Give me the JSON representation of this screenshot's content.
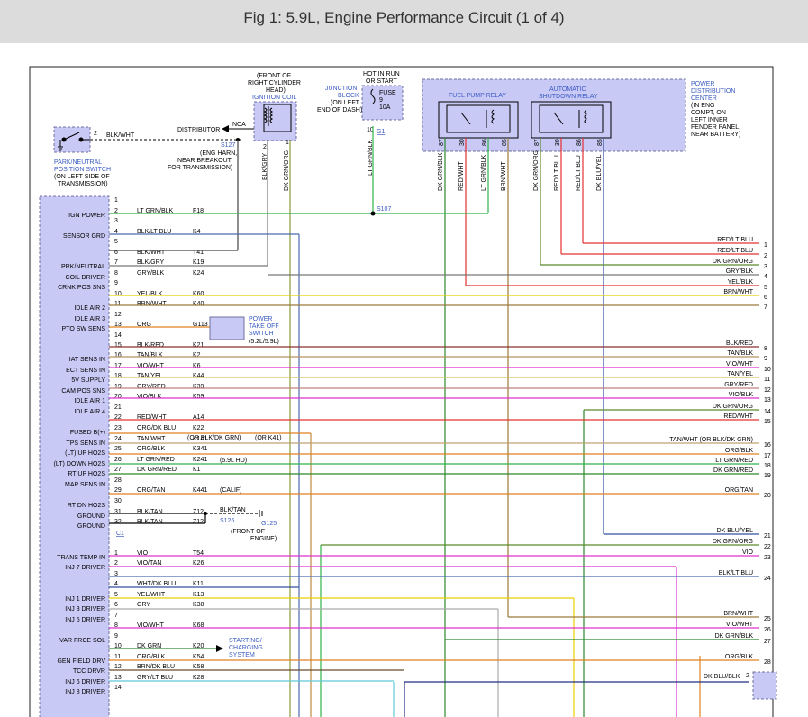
{
  "title": "Fig 1: 5.9L, Engine Performance Circuit (1 of 4)",
  "colors": {
    "box_fill": "#c9c9f5",
    "box_stroke": "#7070a0",
    "label_blue": "#3b5bc2",
    "frame": "#222222"
  },
  "pcm": {
    "c1": "C1",
    "rows": [
      {
        "pin": "1",
        "label": "",
        "wire": "",
        "code": ""
      },
      {
        "pin": "2",
        "label": "IGN POWER",
        "wire": "LT GRN/BLK",
        "code": "F18"
      },
      {
        "pin": "3",
        "label": "",
        "wire": "",
        "code": ""
      },
      {
        "pin": "4",
        "label": "SENSOR GRD",
        "wire": "BLK/LT BLU",
        "code": "K4"
      },
      {
        "pin": "5",
        "label": "",
        "wire": "",
        "code": ""
      },
      {
        "pin": "6",
        "label": "",
        "wire": "BLK/WHT",
        "code": "T41"
      },
      {
        "pin": "7",
        "label": "PRK/NEUTRAL",
        "wire": "BLK/GRY",
        "code": "K19"
      },
      {
        "pin": "8",
        "label": "COIL DRIVER",
        "wire": "GRY/BLK",
        "code": "K24"
      },
      {
        "pin": "9",
        "label": "CRNK POS SNS",
        "wire": "",
        "code": ""
      },
      {
        "pin": "10",
        "label": "",
        "wire": "YEL/BLK",
        "code": "K60"
      },
      {
        "pin": "11",
        "label": "IDLE AIR 2",
        "wire": "BRN/WHT",
        "code": "K40"
      },
      {
        "pin": "12",
        "label": "IDLE AIR 3",
        "wire": "",
        "code": ""
      },
      {
        "pin": "13",
        "label": "PTO SW SENS",
        "wire": "ORG",
        "code": "G113"
      },
      {
        "pin": "14",
        "label": "",
        "wire": "",
        "code": ""
      },
      {
        "pin": "15",
        "label": "",
        "wire": "BLK/RED",
        "code": "K21"
      },
      {
        "pin": "16",
        "label": "IAT SENS IN",
        "wire": "TAN/BLK",
        "code": "K2"
      },
      {
        "pin": "17",
        "label": "ECT SENS IN",
        "wire": "VIO/WHT",
        "code": "K6"
      },
      {
        "pin": "18",
        "label": "5V SUPPLY",
        "wire": "TAN/YEL",
        "code": "K44"
      },
      {
        "pin": "19",
        "label": "CAM POS SNS",
        "wire": "GRY/RED",
        "code": "K39"
      },
      {
        "pin": "20",
        "label": "IDLE AIR 1",
        "wire": "VIO/BLK",
        "code": "K59"
      },
      {
        "pin": "21",
        "label": "IDLE AIR 4",
        "wire": "",
        "code": ""
      },
      {
        "pin": "22",
        "label": "",
        "wire": "RED/WHT",
        "code": "A14"
      },
      {
        "pin": "23",
        "label": "FUSED B(+)",
        "wire": "ORG/DK BLU",
        "code": "K22"
      },
      {
        "pin": "24",
        "label": "TPS SENS IN",
        "wire": "TAN/WHT",
        "code": "K141"
      },
      {
        "pin": "25",
        "label": "(LT) UP HO2S",
        "wire": "ORG/BLK",
        "code": "K341"
      },
      {
        "pin": "26",
        "label": "(LT) DOWN HO2S",
        "wire": "LT GRN/RED",
        "code": "K241"
      },
      {
        "pin": "27",
        "label": "RT UP HO2S",
        "wire": "DK GRN/RED",
        "code": "K1"
      },
      {
        "pin": "28",
        "label": "MAP SENS IN",
        "wire": "",
        "code": ""
      },
      {
        "pin": "29",
        "label": "",
        "wire": "ORG/TAN",
        "code": "K441"
      },
      {
        "pin": "30",
        "label": "RT DN HO2S",
        "wire": "",
        "code": ""
      },
      {
        "pin": "31",
        "label": "GROUND",
        "wire": "BLK/TAN",
        "code": "Z12"
      },
      {
        "pin": "32",
        "label": "GROUND",
        "wire": "BLK/TAN",
        "code": "Z12"
      }
    ],
    "rows2": [
      {
        "pin": "1",
        "label": "TRANS TEMP IN",
        "wire": "VIO",
        "code": "T54"
      },
      {
        "pin": "2",
        "label": "INJ 7 DRIVER",
        "wire": "VIO/TAN",
        "code": "K26"
      },
      {
        "pin": "3",
        "label": "",
        "wire": "",
        "code": ""
      },
      {
        "pin": "4",
        "label": "",
        "wire": "WHT/DK BLU",
        "code": "K11"
      },
      {
        "pin": "5",
        "label": "INJ 1 DRIVER",
        "wire": "YEL/WHT",
        "code": "K13"
      },
      {
        "pin": "6",
        "label": "INJ 3 DRIVER",
        "wire": "GRY",
        "code": "K38"
      },
      {
        "pin": "7",
        "label": "INJ 5 DRIVER",
        "wire": "",
        "code": ""
      },
      {
        "pin": "8",
        "label": "",
        "wire": "VIO/WHT",
        "code": "K68"
      },
      {
        "pin": "9",
        "label": "VAR FRCE SOL",
        "wire": "",
        "code": ""
      },
      {
        "pin": "10",
        "label": "",
        "wire": "DK GRN",
        "code": "K20"
      },
      {
        "pin": "11",
        "label": "GEN FIELD DRV",
        "wire": "ORG/BLK",
        "code": "K54"
      },
      {
        "pin": "12",
        "label": "TCC DRVR",
        "wire": "BRN/DK BLU",
        "code": "K58"
      },
      {
        "pin": "13",
        "label": "INJ 6 DRIVER",
        "wire": "GRY/LT BLU",
        "code": "K28"
      },
      {
        "pin": "14",
        "label": "INJ 8 DRIVER",
        "wire": "",
        "code": ""
      }
    ]
  },
  "right_wires": [
    {
      "num": "1",
      "label": "RED/LT BLU"
    },
    {
      "num": "2",
      "label": "RED/LT BLU"
    },
    {
      "num": "3",
      "label": "DK GRN/ORG"
    },
    {
      "num": "4",
      "label": "GRY/BLK"
    },
    {
      "num": "5",
      "label": "YEL/BLK"
    },
    {
      "num": "6",
      "label": "BRN/WHT"
    },
    {
      "num": "7",
      "label": ""
    },
    {
      "num": "8",
      "label": "BLK/RED"
    },
    {
      "num": "9",
      "label": "TAN/BLK"
    },
    {
      "num": "10",
      "label": "VIO/WHT"
    },
    {
      "num": "11",
      "label": "TAN/YEL"
    },
    {
      "num": "12",
      "label": "GRY/RED"
    },
    {
      "num": "13",
      "label": "VIO/BLK"
    },
    {
      "num": "14",
      "label": "DK GRN/ORG"
    },
    {
      "num": "15",
      "label": "RED/WHT"
    },
    {
      "num": "16",
      "label": "TAN/WHT (OR BLK/DK GRN)"
    },
    {
      "num": "17",
      "label": "ORG/BLK"
    },
    {
      "num": "18",
      "label": "LT GRN/RED"
    },
    {
      "num": "19",
      "label": "DK GRN/RED"
    },
    {
      "num": "20",
      "label": "ORG/TAN"
    },
    {
      "num": "21",
      "label": "DK BLU/YEL"
    },
    {
      "num": "22",
      "label": "DK GRN/ORG"
    },
    {
      "num": "23",
      "label": "VIO"
    },
    {
      "num": "24",
      "label": "BLK/LT BLU"
    },
    {
      "num": "25",
      "label": "BRN/WHT"
    },
    {
      "num": "26",
      "label": "VIO/WHT"
    },
    {
      "num": "27",
      "label": "DK GRN/BLK"
    },
    {
      "num": "28",
      "label": "ORG/BLK"
    }
  ],
  "labels": {
    "coil_front": "(FRONT OF",
    "coil_right": "RIGHT CYLINDER",
    "coil_head": "HEAD)",
    "coil_name": "IGNITION COIL",
    "distributor": "DISTRIBUTOR",
    "nca": "NCA",
    "s127": "S127",
    "eng_harn1": "(ENG HARN,",
    "eng_harn2": "NEAR BREAKOUT",
    "eng_harn3": "FOR TRANSMISSION)",
    "park_wire": "BLK/WHT",
    "park1": "PARK/NEUTRAL",
    "park2": "POSITION SWITCH",
    "park3": "(ON LEFT SIDE OF",
    "park4": "TRANSMISSION)",
    "jb1": "JUNCTION",
    "jb2": "BLOCK",
    "jb3": "(ON LEFT",
    "jb4": "END OF DASH)",
    "hot1": "HOT IN RUN",
    "hot2": "OR START",
    "fuse1": "FUSE",
    "fuse2": "9",
    "fuse3": "10A",
    "g1": "G1",
    "fuel_pump": "FUEL PUMP RELAY",
    "asd1": "AUTOMATIC",
    "asd2": "SHUTDOWN RELAY",
    "pdc1": "POWER",
    "pdc2": "DISTRIBUTION",
    "pdc3": "CENTER",
    "pdc4": "(IN ENG",
    "pdc5": "COMPT, ON",
    "pdc6": "LEFT INNER",
    "pdc7": "FENDER PANEL,",
    "pdc8": "NEAR BATTERY)",
    "s107": "S107",
    "pto1": "POWER",
    "pto2": "TAKE OFF",
    "pto3": "SWITCH",
    "pto4": "(5.2L/5.9L)",
    "or_blk": "(OR BLK/DK GRN)",
    "or_k41": "(OR K41)",
    "hd": "(5.9L HD)",
    "calif": "(CALIF)",
    "blk_tan": "BLK/TAN",
    "s126": "S126",
    "g125": "G125",
    "front_eng1": "(FRONT OF",
    "front_eng2": "ENGINE)",
    "starting1": "STARTING/",
    "starting2": "CHARGING",
    "starting3": "SYSTEM",
    "dk_blu_blk": "DK BLU/BLK",
    "pin2": "2",
    "vw_ltgrnblk": "LT GRN/BLK",
    "vw_10": "10",
    "vw_blkgry": "BLK/GRY",
    "vw_dkgrnorg": "DK GRN/ORG",
    "vw_2": "2",
    "vw_1": "1",
    "relay_pins": [
      "87",
      "30",
      "86",
      "85",
      "87",
      "30",
      "86",
      "85"
    ],
    "relay_wires": [
      "DK GRN/BLK",
      "RED/WHT",
      "LT GRN/BLK",
      "BRN/WHT",
      "DK GRN/ORG",
      "RED/LT BLU",
      "RED/LT BLU",
      "DK BLU/YEL"
    ]
  }
}
